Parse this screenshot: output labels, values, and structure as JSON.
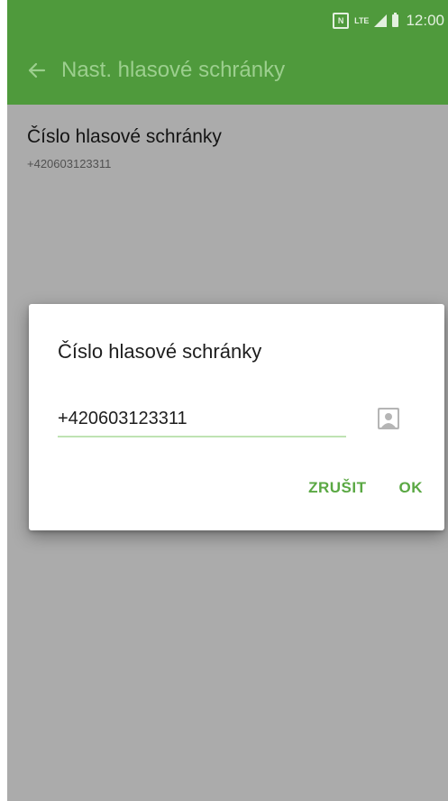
{
  "status_bar": {
    "nfc_icon": "nfc-icon",
    "network": "LTE",
    "signal_icon": "signal-icon",
    "battery_icon": "battery-icon",
    "time": "12:00"
  },
  "toolbar": {
    "back_icon": "back-arrow-icon",
    "title": "Nast. hlasové schránky"
  },
  "preferences": [
    {
      "title": "Číslo hlasové schránky",
      "summary": "+420603123311"
    }
  ],
  "dialog": {
    "title": "Číslo hlasové schránky",
    "input_value": "+420603123311",
    "contact_icon": "contact-picker-icon",
    "cancel_label": "ZRUŠIT",
    "ok_label": "OK"
  },
  "colors": {
    "app_bar": "#4f9a3c",
    "title_text": "#9ccf8e",
    "accent": "#5aa843",
    "input_underline": "#bfe3b3"
  }
}
